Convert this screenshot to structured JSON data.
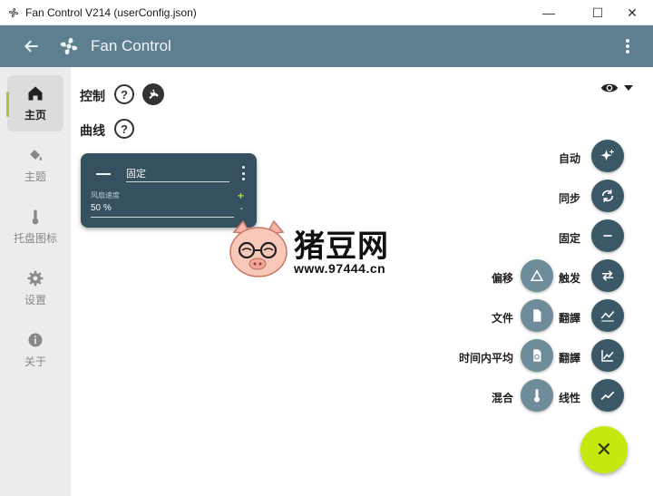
{
  "window": {
    "title": "Fan Control V214 (userConfig.json)",
    "minimize": "—",
    "maximize": "☐",
    "close": "✕"
  },
  "appbar": {
    "title": "Fan Control"
  },
  "sidebar": {
    "items": [
      {
        "label": "主页",
        "icon": "home-icon",
        "active": true
      },
      {
        "label": "主题",
        "icon": "paint-bucket-icon",
        "active": false
      },
      {
        "label": "托盘图标",
        "icon": "thermometer-icon",
        "active": false
      },
      {
        "label": "设置",
        "icon": "gear-icon",
        "active": false
      },
      {
        "label": "关于",
        "icon": "info-icon",
        "active": false
      }
    ]
  },
  "main": {
    "controls_label": "控制",
    "curves_label": "曲线",
    "help_glyph": "?",
    "card": {
      "name": "固定",
      "speed_label": "风扇速度",
      "speed_value": "50 %",
      "plus": "+",
      "minus": "-"
    }
  },
  "speed_dial": {
    "right": [
      {
        "label": "自动",
        "icon": "sparkle-icon"
      },
      {
        "label": "同步",
        "icon": "sync-icon"
      },
      {
        "label": "固定",
        "icon": "minus-icon"
      },
      {
        "label": "触发",
        "icon": "swap-arrows-icon"
      },
      {
        "label": "翻譯",
        "icon": "graph-zigzag-icon"
      },
      {
        "label": "翻譯",
        "icon": "graph-steps-icon"
      },
      {
        "label": "线性",
        "icon": "trend-line-icon"
      }
    ],
    "left": [
      {
        "label": "偏移",
        "icon": "triangle-icon"
      },
      {
        "label": "文件",
        "icon": "file-icon"
      },
      {
        "label": "时间内平均",
        "icon": "clock-file-icon"
      },
      {
        "label": "混合",
        "icon": "thermometer-icon"
      }
    ],
    "close_glyph": "✕"
  },
  "watermark": {
    "text": "猪豆网",
    "url": "www.97444.cn"
  },
  "colors": {
    "accent": "#c6e80f",
    "appbar": "#5e7f8f",
    "card": "#35515f",
    "fab": "#3a5866"
  }
}
